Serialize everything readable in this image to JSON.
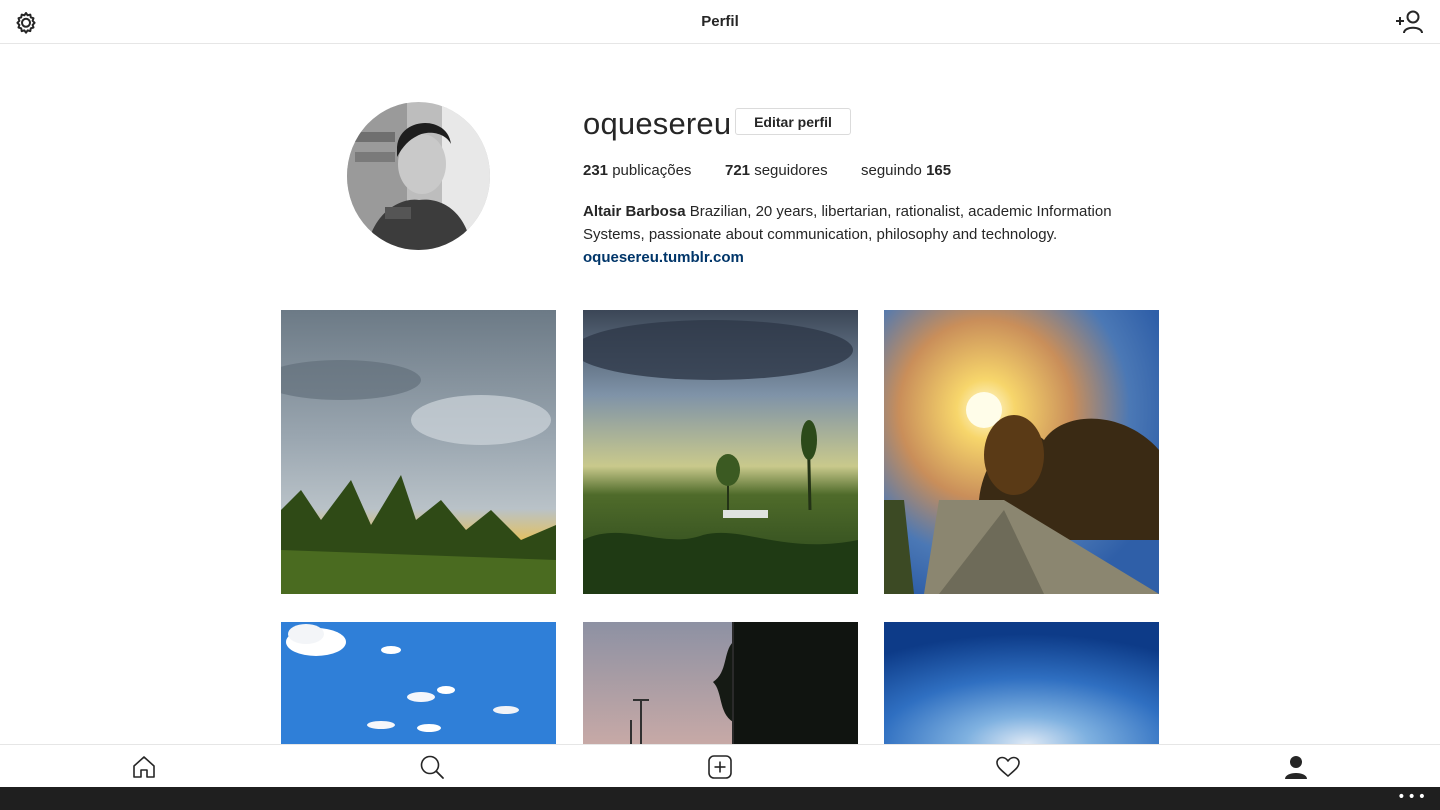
{
  "header": {
    "title": "Perfil",
    "settings_icon": "gear-icon",
    "add_user_icon": "add-user-icon"
  },
  "profile": {
    "username": "oquesereu",
    "edit_label": "Editar perfil",
    "posts_count": "231",
    "posts_label": "publicações",
    "followers_count": "721",
    "followers_label": "seguidores",
    "following_label": "seguindo",
    "following_count": "165",
    "full_name": "Altair Barbosa",
    "bio": "Brazilian, 20 years, libertarian, rationalist, academic Information Systems, passionate about communication, philosophy and technology.",
    "website": "oquesereu.tumblr.com"
  },
  "grid": {
    "posts": [
      {
        "name": "photo-cloudy-sky-plants"
      },
      {
        "name": "photo-field-trees-clouds"
      },
      {
        "name": "photo-sunset-road"
      },
      {
        "name": "photo-blue-sky-clouds"
      },
      {
        "name": "photo-trees-street-lights"
      },
      {
        "name": "photo-blue-sky-sun"
      }
    ]
  },
  "bottom_nav": {
    "items": [
      {
        "icon": "home-icon"
      },
      {
        "icon": "search-icon"
      },
      {
        "icon": "add-post-icon"
      },
      {
        "icon": "heart-icon"
      },
      {
        "icon": "profile-icon"
      }
    ]
  },
  "colors": {
    "link": "#003569",
    "text": "#262626",
    "taskbar": "#1f1f1f"
  }
}
